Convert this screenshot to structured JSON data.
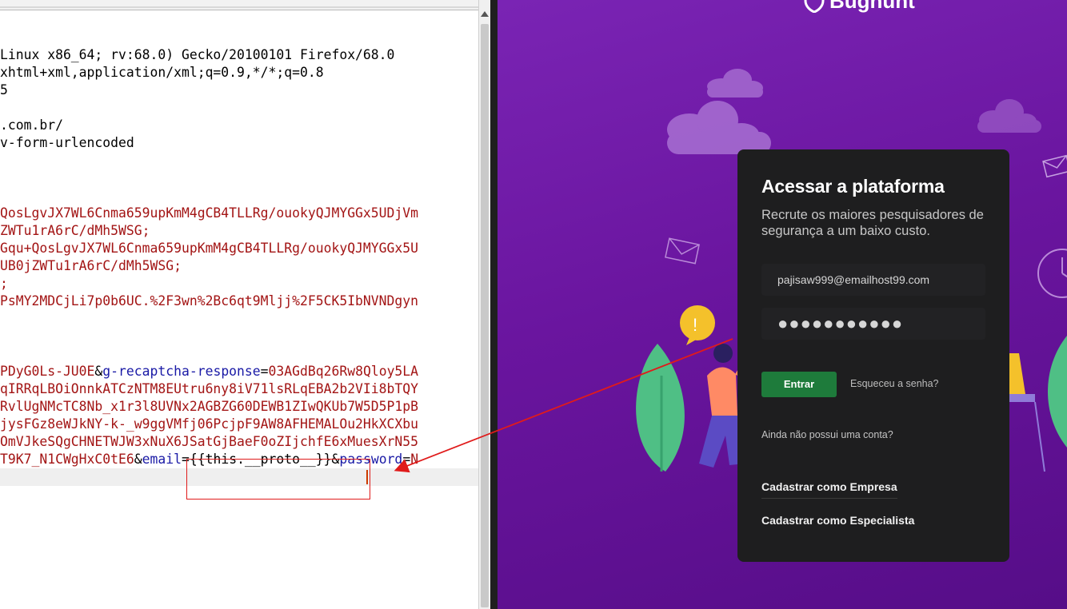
{
  "editor": {
    "lines": [
      [
        {
          "t": "Linux x86_64; rv:68.0) Gecko/20100101 Firefox/68.0",
          "c": "p"
        }
      ],
      [
        {
          "t": "xhtml+xml,application/xml;q=0.9,*/*;q=0.8",
          "c": "p"
        }
      ],
      [
        {
          "t": "5",
          "c": "p"
        }
      ],
      [
        {
          "t": "",
          "c": "p"
        }
      ],
      [
        {
          "t": ".com.br/",
          "c": "p"
        }
      ],
      [
        {
          "t": "v-form-urlencoded",
          "c": "p"
        }
      ],
      [
        {
          "t": "",
          "c": "p"
        }
      ],
      [
        {
          "t": "",
          "c": "p"
        }
      ],
      [
        {
          "t": "",
          "c": "p"
        }
      ],
      [
        {
          "t": "QosLgvJX7WL6Cnma659upKmM4gCB4TLLRg/ouokyQJMYGGx5UDjVm",
          "c": "v"
        }
      ],
      [
        {
          "t": "ZWTu1rA6rC/dMh5WSG;",
          "c": "v"
        }
      ],
      [
        {
          "t": "Gqu+QosLgvJX7WL6Cnma659upKmM4gCB4TLLRg/ouokyQJMYGGx5U",
          "c": "v"
        }
      ],
      [
        {
          "t": "UB0jZWTu1rA6rC/dMh5WSG;",
          "c": "v"
        }
      ],
      [
        {
          "t": ";",
          "c": "v"
        }
      ],
      [
        {
          "t": "PsMY2MDCjLi7p0b6UC.%2F3wn%2Bc6qt9Mljj%2F5CK5IbNVNDgyn",
          "c": "v"
        }
      ],
      [
        {
          "t": "",
          "c": "p"
        }
      ],
      [
        {
          "t": "",
          "c": "p"
        }
      ],
      [
        {
          "t": "",
          "c": "p"
        }
      ],
      [
        {
          "t": "PDyG0Ls-JU0E",
          "c": "v"
        },
        {
          "t": "&",
          "c": "p"
        },
        {
          "t": "g-recaptcha-response",
          "c": "k"
        },
        {
          "t": "=",
          "c": "p"
        },
        {
          "t": "03AGdBq26Rw8Qloy5LA",
          "c": "v"
        }
      ],
      [
        {
          "t": "qIRRqLBOiOnnkATCzNTM8EUtru6ny8iV71lsRLqEBA2b2VIi8bTQY",
          "c": "v"
        }
      ],
      [
        {
          "t": "RvlUgNMcTC8Nb_x1r3l8UVNx2AGBZG60DEWB1ZIwQKUb7W5D5P1pB",
          "c": "v"
        }
      ],
      [
        {
          "t": "jysFGz8eWJkNY-k-_w9ggVMfj06PcjpF9AW8AFHEMALOu2HkXCXbu",
          "c": "v"
        }
      ],
      [
        {
          "t": "OmVJkeSQgCHNETWJW3xNuX6JSatGjBaeF0oZIjchfE6xMuesXrN55",
          "c": "v"
        }
      ],
      [
        {
          "t": "T9K7_N1CWgHxC0tE6",
          "c": "v"
        },
        {
          "t": "&",
          "c": "p"
        },
        {
          "t": "email",
          "c": "k"
        },
        {
          "t": "=",
          "c": "p"
        },
        {
          "t": "{{this.__proto__}}",
          "c": "p"
        },
        {
          "t": "&",
          "c": "p"
        },
        {
          "t": "password",
          "c": "k"
        },
        {
          "t": "=",
          "c": "p"
        },
        {
          "t": "N",
          "c": "v"
        }
      ]
    ]
  },
  "app": {
    "brand": "Bughunt",
    "card": {
      "title": "Acessar a plataforma",
      "subtitle": "Recrute os maiores pesquisadores de segurança a um baixo custo.",
      "email_value": "pajisaw999@emailhost99.com",
      "password_value": "●●●●●●●●●●●",
      "login_button": "Entrar",
      "forgot_link": "Esqueceu a senha?",
      "no_account_text": "Ainda não possui uma conta?",
      "register_company": "Cadastrar como Empresa",
      "register_expert": "Cadastrar como Especialista"
    }
  },
  "colors": {
    "param_value": "#a31515",
    "param_key": "#1a1aa6",
    "annotation": "#e01b1b",
    "app_bg": "#6a159f",
    "card_bg": "#1e1e1f",
    "login_button": "#1e7b3b"
  }
}
